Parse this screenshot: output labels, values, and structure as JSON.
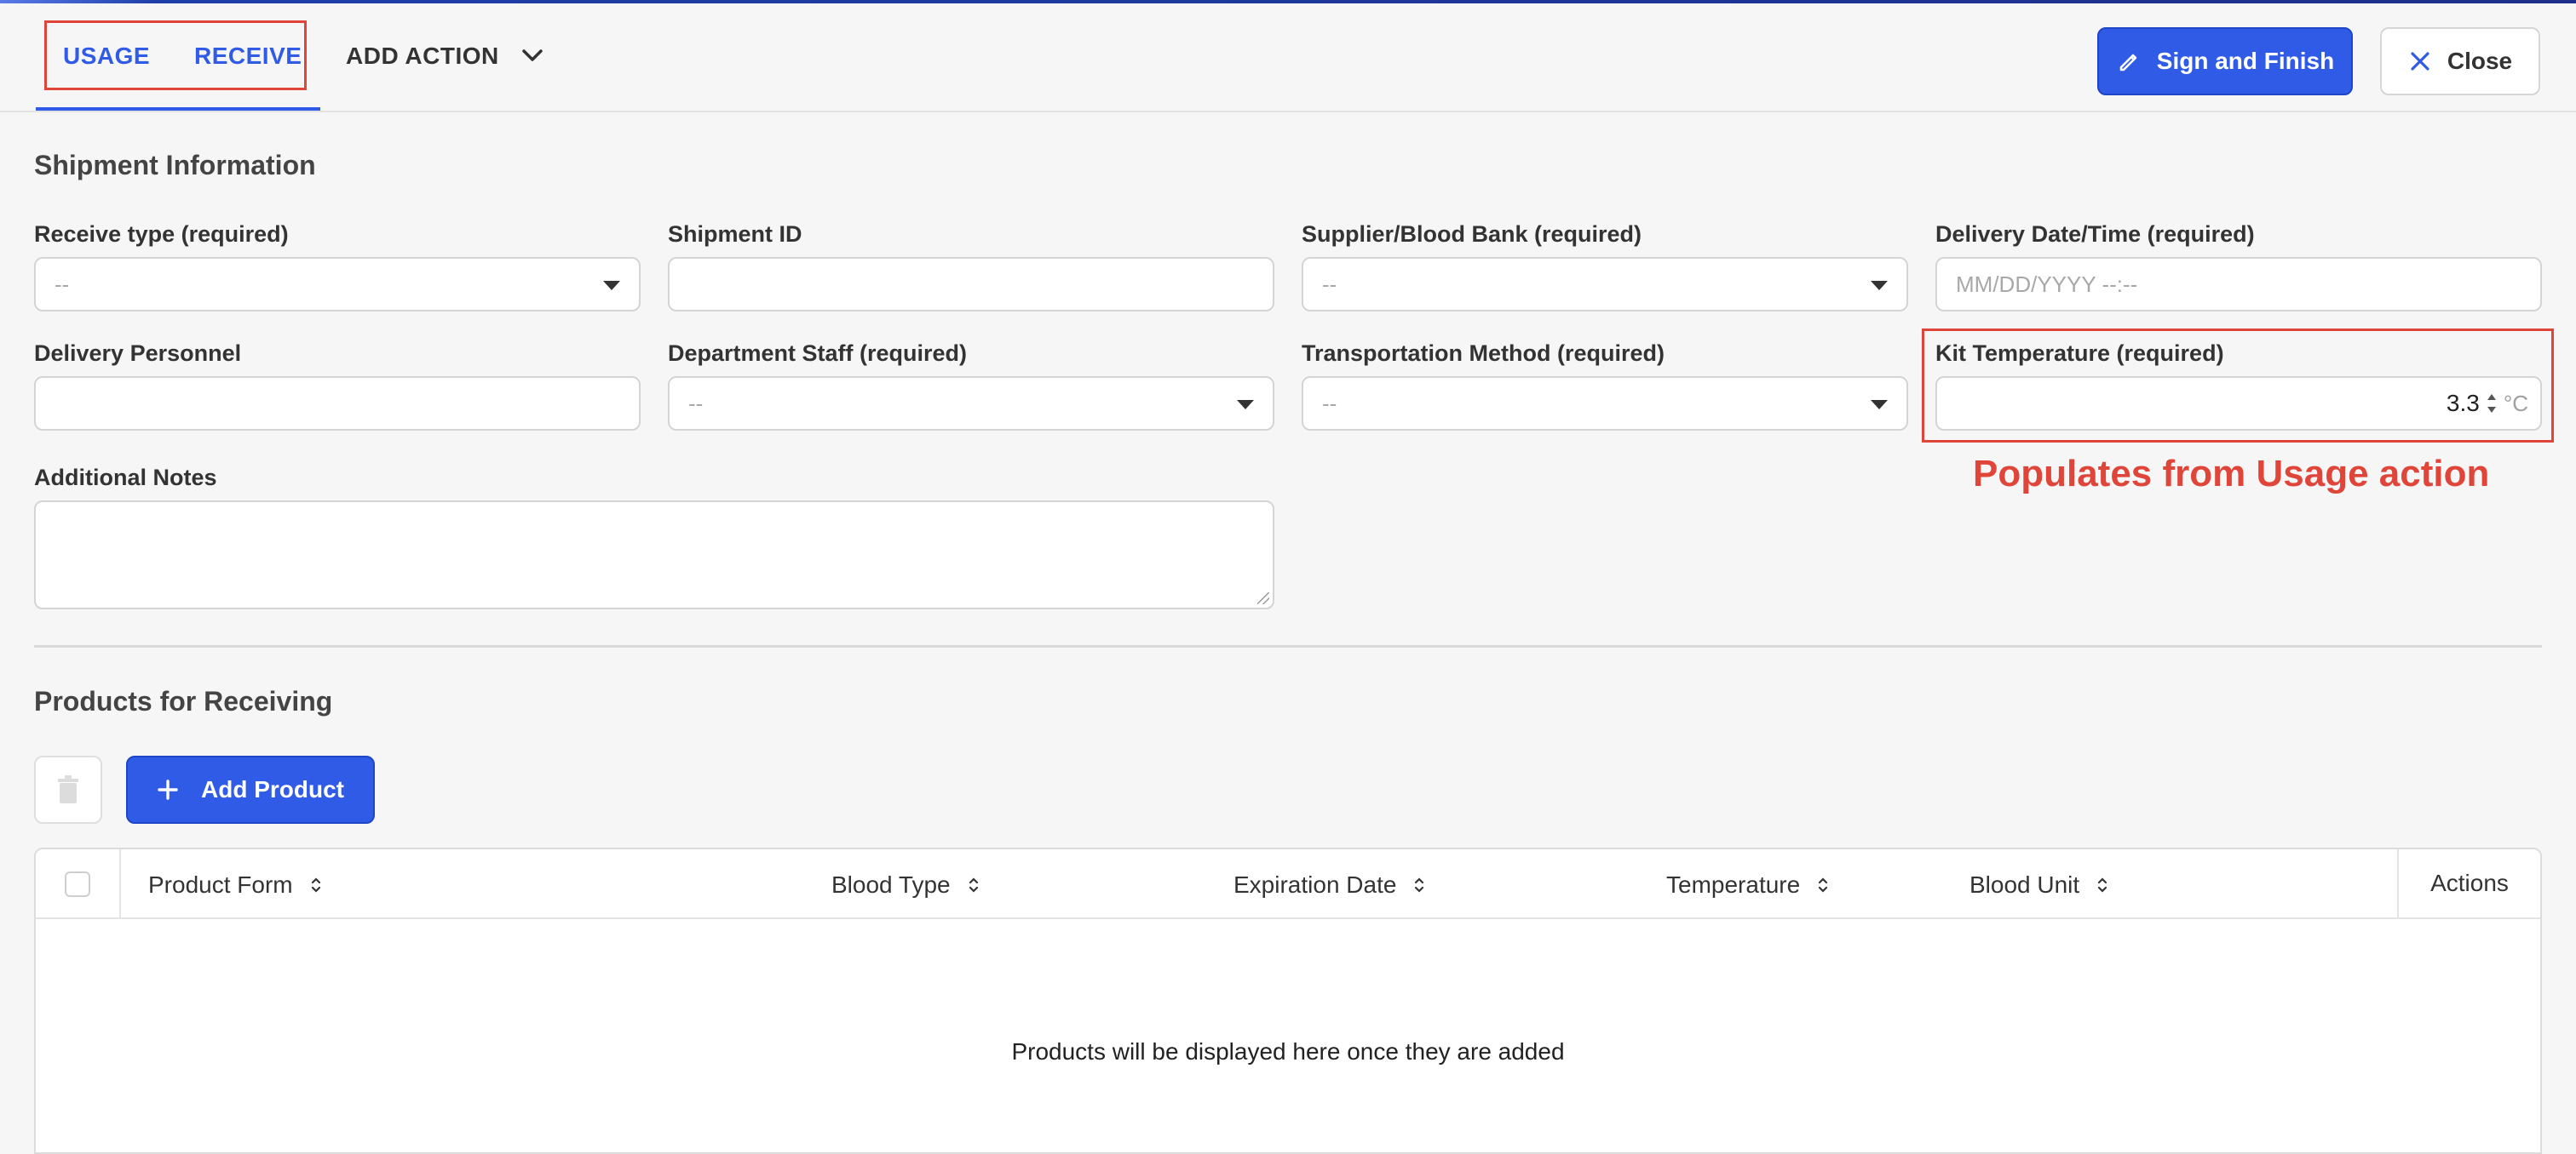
{
  "tabs": {
    "usage": "USAGE",
    "receive": "RECEIVE",
    "add_action": "ADD ACTION"
  },
  "header_buttons": {
    "sign_finish": "Sign and Finish",
    "close": "Close"
  },
  "shipment": {
    "title": "Shipment Information",
    "receive_type": {
      "label": "Receive type (required)",
      "value": "--"
    },
    "shipment_id": {
      "label": "Shipment ID",
      "value": ""
    },
    "supplier": {
      "label": "Supplier/Blood Bank (required)",
      "value": "--"
    },
    "delivery_datetime": {
      "label": "Delivery Date/Time (required)",
      "placeholder": "MM/DD/YYYY --:--"
    },
    "delivery_personnel": {
      "label": "Delivery Personnel",
      "value": ""
    },
    "department_staff": {
      "label": "Department Staff (required)",
      "value": "--"
    },
    "transport_method": {
      "label": "Transportation Method (required)",
      "value": "--"
    },
    "kit_temperature": {
      "label": "Kit Temperature (required)",
      "value": "3.3",
      "unit": "°C"
    },
    "additional_notes": {
      "label": "Additional Notes",
      "value": ""
    }
  },
  "annotation": "Populates from Usage action",
  "products": {
    "title": "Products for Receiving",
    "add_button": "Add Product",
    "columns": [
      "Product Form",
      "Blood Type",
      "Expiration Date",
      "Temperature",
      "Blood Unit"
    ],
    "actions_header": "Actions",
    "empty_message": "Products will be displayed here once they are added"
  },
  "colors": {
    "accent": "#2f5be6",
    "annotation_red": "#e0453a"
  }
}
